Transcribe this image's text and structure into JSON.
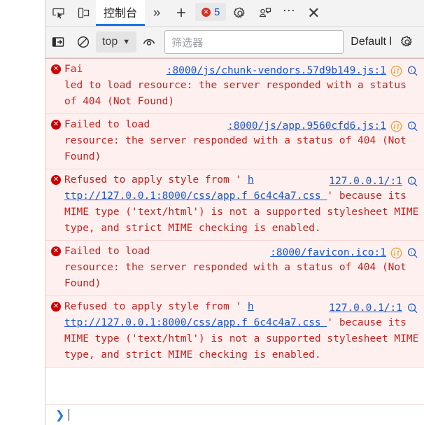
{
  "window": {
    "panel_title": "DevTools Console"
  },
  "tabbar": {
    "inspect_icon": "inspect-element-icon",
    "device_icon": "device-toolbar-icon",
    "tabs": [
      {
        "label": "控制台",
        "active": true
      }
    ],
    "more_tabs_label": "»",
    "add_tab_label": "+",
    "error_badge": {
      "icon_glyph": "✕",
      "count": "5"
    },
    "settings_icon": "gear-icon",
    "feedback_icon": "feedback-icon",
    "more_options_label": "⋯",
    "close_label": "✕"
  },
  "filterbar": {
    "sidebar_toggle_icon": "show-console-sidebar-icon",
    "clear_icon": "clear-console-icon",
    "context": {
      "value": "top",
      "caret": "▼"
    },
    "eye_icon": "live-expression-icon",
    "filter": {
      "placeholder": "筛选器",
      "value": ""
    },
    "levels_label": "Default l",
    "settings_icon": "console-settings-icon"
  },
  "console": {
    "messages": [
      {
        "level": "error",
        "icon_glyph": "✕",
        "segments": [
          {
            "text": "Fai",
            "link": false
          },
          {
            "text": "led",
            "link": false
          },
          {
            "text": "to load resource: the server responded with a status of 404 (Not Found)",
            "link": false
          }
        ],
        "source": ":8000/js/chunk-vendors.57d9b149.js:1",
        "network_icon": "network-request-icon",
        "search_icon": "search-in-issues-icon",
        "head_width": 46
      },
      {
        "level": "error",
        "icon_glyph": "✕",
        "segments": [
          {
            "text": "Failed to",
            "link": false
          },
          {
            "text": "load",
            "link": false
          },
          {
            "text": "resource: the server responded with a status of 404 (Not Found)",
            "link": false
          }
        ],
        "source": ":8000/js/app.9560cfd6.js:1",
        "network_icon": "network-request-icon",
        "search_icon": "search-in-issues-icon",
        "head_width": 120
      },
      {
        "level": "error",
        "icon_glyph": "✕",
        "segments": [
          {
            "text": "Refused to apply style from '",
            "link": false
          },
          {
            "text": "h",
            "link": true
          },
          {
            "text": "ttp://127.0.0.1:8000/css/app.f",
            "link": true
          },
          {
            "text": "6c4c4a7.css",
            "link": true
          },
          {
            "text": "' because its MIME type ('text/html') is not a supported stylesheet MIME type, and strict MIME checking is enabled.",
            "link": false
          }
        ],
        "source": "127.0.0.1/:1",
        "network_icon": "",
        "search_icon": "search-in-issues-icon",
        "head_width": 300
      },
      {
        "level": "error",
        "icon_glyph": "✕",
        "segments": [
          {
            "text": "Failed to load",
            "link": false
          },
          {
            "text": "resource: the server",
            "link": false
          },
          {
            "text": "responded with a status of 404 (Not Found)",
            "link": false
          }
        ],
        "source": ":8000/favicon.ico:1",
        "network_icon": "network-request-icon",
        "search_icon": "search-in-issues-icon",
        "head_width": 160
      },
      {
        "level": "error",
        "icon_glyph": "✕",
        "segments": [
          {
            "text": "Refused to apply style from '",
            "link": false
          },
          {
            "text": "h",
            "link": true
          },
          {
            "text": "ttp://127.0.0.1:8000/css/app.f",
            "link": true
          },
          {
            "text": "6c4c4a7.css",
            "link": true
          },
          {
            "text": "' because its MIME type ('text/html') is not a supported stylesheet MIME type, and strict MIME checking is enabled.",
            "link": false
          }
        ],
        "source": "127.0.0.1/:1",
        "network_icon": "",
        "search_icon": "search-in-issues-icon",
        "head_width": 300
      }
    ]
  },
  "prompt": {
    "chevron": "❯",
    "value": ""
  },
  "colors": {
    "error_text": "#c5221f",
    "error_bg": "#fdf0ef",
    "link": "#1a56c5",
    "accent": "#1a73e8",
    "error_icon": "#cc0000",
    "network_icon": "#e8a33d"
  }
}
